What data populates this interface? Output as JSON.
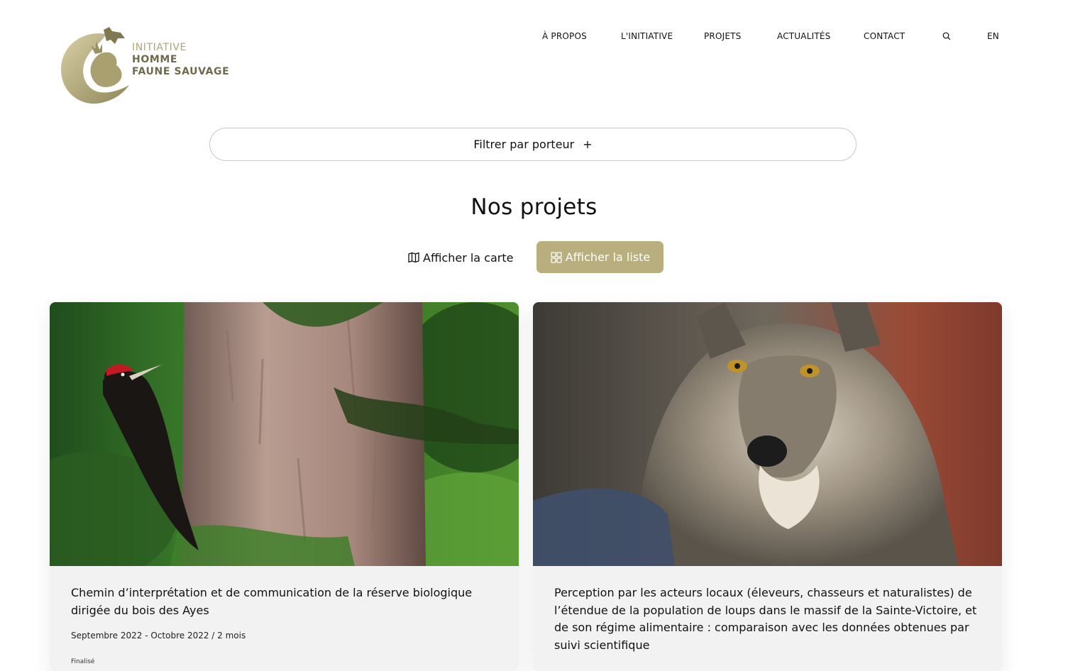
{
  "logo": {
    "line1": "INITIATIVE",
    "line2": "HOMME",
    "line3": "FAUNE SAUVAGE",
    "color": "#b0a57a"
  },
  "nav": {
    "items": [
      {
        "label": "À PROPOS"
      },
      {
        "label": "L'INITIATIVE"
      },
      {
        "label": "PROJETS"
      },
      {
        "label": "ACTUALITÉS"
      },
      {
        "label": "CONTACT"
      }
    ],
    "search_icon": "search-icon",
    "language": "EN"
  },
  "filter": {
    "label": "Filtrer par porteur",
    "plus": "+"
  },
  "main": {
    "title": "Nos projets",
    "view_toggle": {
      "map_label": "Afficher la carte",
      "map_icon": "map-icon",
      "list_label": "Afficher la liste",
      "list_icon": "grid-icon",
      "active": "list",
      "accent_color": "#b8ae7e"
    }
  },
  "projects": [
    {
      "title": "Chemin d’interprétation et de communication de la réserve biologique dirigée du bois des Ayes",
      "date": "Septembre 2022 - Octobre 2022 / 2 mois",
      "status": "Finalisé",
      "image": "black woodpecker on tree trunk"
    },
    {
      "title": "Perception par les acteurs locaux (éleveurs, chasseurs et naturalistes) de l’étendue de la population de loups dans le massif de la Sainte-Victoire, et de son régime alimentaire : comparaison avec les données obtenues par suivi scientifique",
      "date": "",
      "status": "",
      "image": "grey wolf portrait"
    }
  ]
}
